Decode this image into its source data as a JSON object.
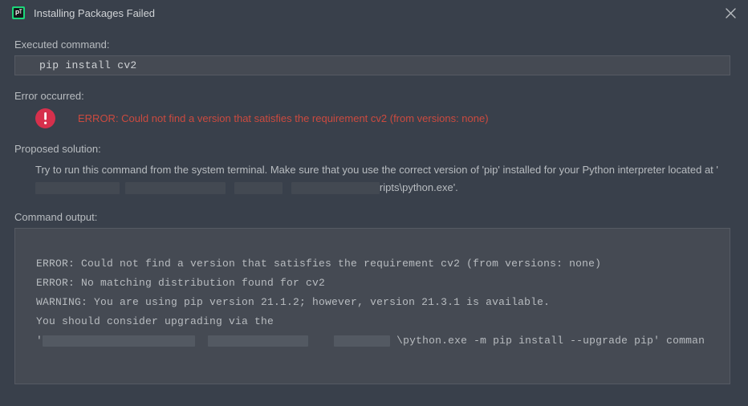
{
  "title": "Installing Packages Failed",
  "labels": {
    "executed_command": "Executed command:",
    "error_occurred": "Error occurred:",
    "proposed_solution": "Proposed solution:",
    "command_output": "Command output:"
  },
  "executed_command": "pip install cv2",
  "error_message": "ERROR: Could not find a version that satisfies the requirement cv2 (from versions: none)",
  "solution": {
    "prefix": "Try to run this command from the system terminal. Make sure that you use the correct version of 'pip' installed for your Python interpreter located at '",
    "suffix": "ripts\\python.exe'."
  },
  "output": {
    "line1": "ERROR: Could not find a version that satisfies the requirement cv2 (from versions: none)",
    "line2": "ERROR: No matching distribution found for cv2",
    "line3": "WARNING: You are using pip version 21.1.2; however, version 21.3.1 is available.",
    "line4": "You should consider upgrading via the",
    "line5_suffix": "\\python.exe -m pip install --upgrade pip' comman"
  }
}
